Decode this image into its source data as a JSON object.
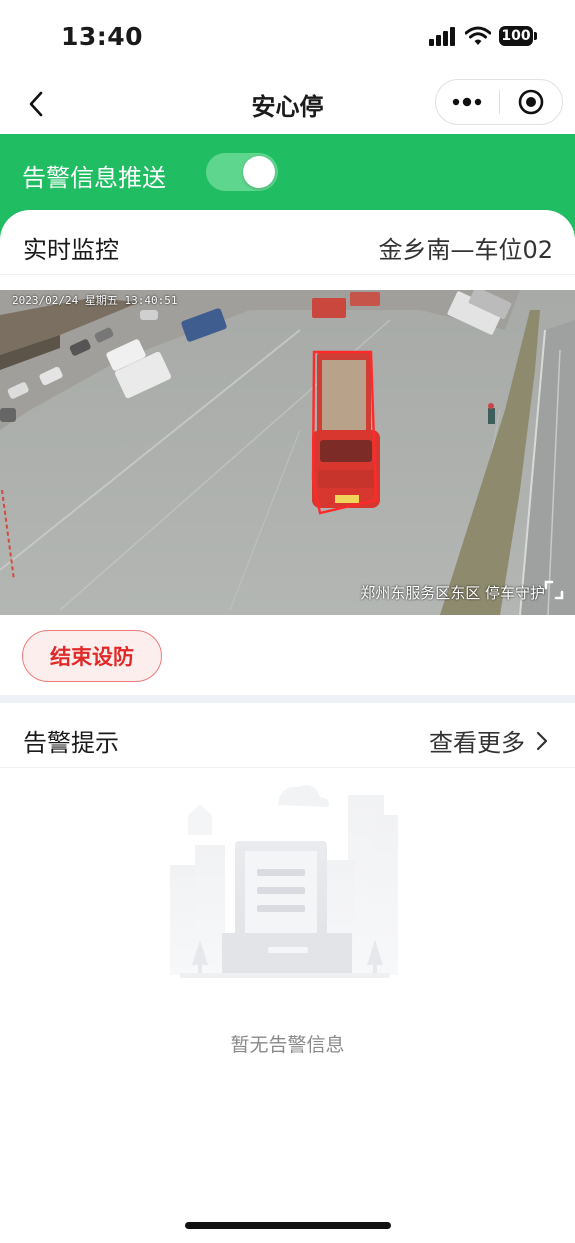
{
  "status_bar": {
    "time": "13:40",
    "battery": "100"
  },
  "nav": {
    "title": "安心停"
  },
  "alert_push": {
    "label": "告警信息推送",
    "enabled": true
  },
  "monitor": {
    "title": "实时监控",
    "slot": "金乡南—车位02",
    "timestamp": "2023/02/24 星期五 13:40:51",
    "watermark": "郑州东服务区东区 停车守护"
  },
  "actions": {
    "end_defense_label": "结束设防"
  },
  "alerts": {
    "title": "告警提示",
    "see_more_label": "查看更多",
    "empty_text": "暂无告警信息"
  },
  "colors": {
    "primary_green": "#21bd63",
    "danger_red": "#e02a2a"
  }
}
